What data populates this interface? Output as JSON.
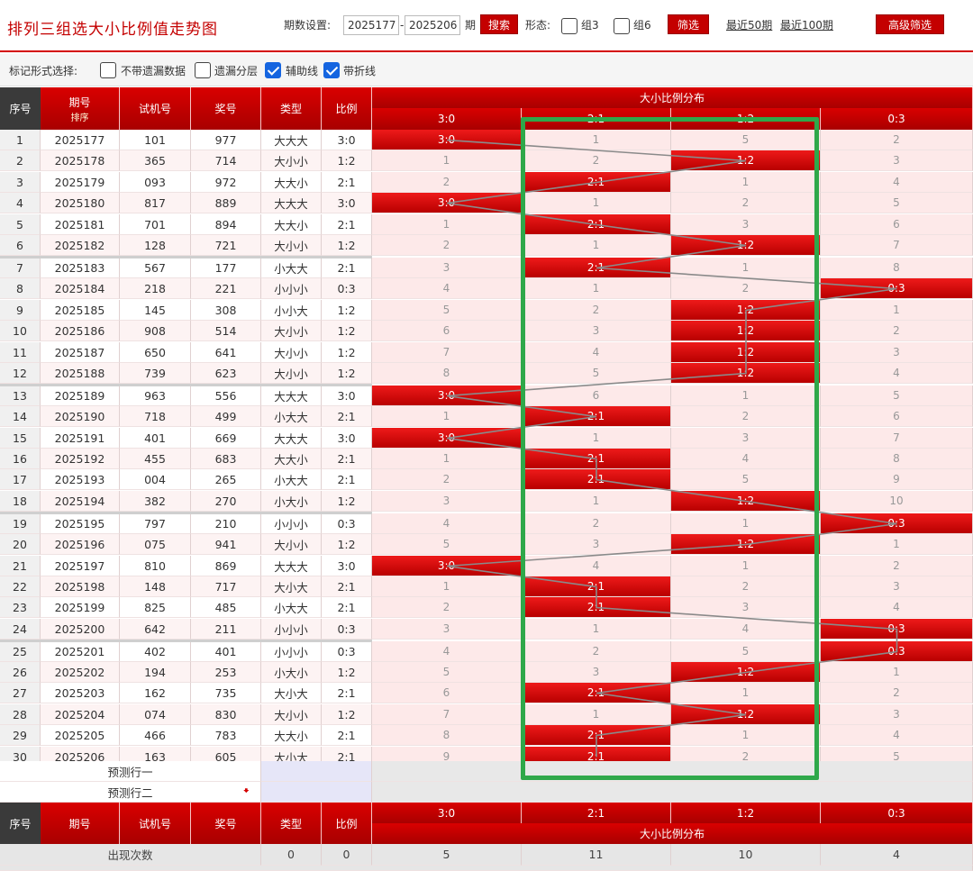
{
  "header": {
    "title": "排列三组选大小比例值走势图",
    "period_label": "期数设置:",
    "period_from": "2025177",
    "period_dash": "-",
    "period_to": "2025206",
    "period_unit": "期",
    "search_button": "搜索",
    "form_label": "形态:",
    "group3_label": "组3",
    "group6_label": "组6",
    "filter_button": "筛选",
    "recent50": "最近50期",
    "recent100": "最近100期",
    "advanced_button": "高级筛选"
  },
  "mark_options": {
    "label": "标记形式选择:",
    "no_missing": "不带遗漏数据",
    "missing_layer": "遗漏分层",
    "assist_line": "辅助线",
    "fold_line": "带折线",
    "no_missing_checked": false,
    "missing_layer_checked": false,
    "assist_line_checked": true,
    "fold_line_checked": true
  },
  "table_header": {
    "seq": "序号",
    "period": "期号",
    "sort": "排序",
    "test_num": "试机号",
    "prize_num": "奖号",
    "type": "类型",
    "ratio": "比例",
    "distribution": "大小比例分布",
    "ratio_cols": [
      "3:0",
      "2:1",
      "1:2",
      "0:3"
    ]
  },
  "rows": [
    {
      "seq": "1",
      "period": "2025177",
      "test": "101",
      "prize": "977",
      "type": "大大大",
      "ratio": "3:0",
      "hit": 0,
      "cells": [
        "3:0",
        "1",
        "5",
        "2"
      ]
    },
    {
      "seq": "2",
      "period": "2025178",
      "test": "365",
      "prize": "714",
      "type": "大小小",
      "ratio": "1:2",
      "hit": 2,
      "cells": [
        "1",
        "2",
        "1:2",
        "3"
      ]
    },
    {
      "seq": "3",
      "period": "2025179",
      "test": "093",
      "prize": "972",
      "type": "大大小",
      "ratio": "2:1",
      "hit": 1,
      "cells": [
        "2",
        "2:1",
        "1",
        "4"
      ]
    },
    {
      "seq": "4",
      "period": "2025180",
      "test": "817",
      "prize": "889",
      "type": "大大大",
      "ratio": "3:0",
      "hit": 0,
      "cells": [
        "3:0",
        "1",
        "2",
        "5"
      ]
    },
    {
      "seq": "5",
      "period": "2025181",
      "test": "701",
      "prize": "894",
      "type": "大大小",
      "ratio": "2:1",
      "hit": 1,
      "cells": [
        "1",
        "2:1",
        "3",
        "6"
      ]
    },
    {
      "seq": "6",
      "period": "2025182",
      "test": "128",
      "prize": "721",
      "type": "大小小",
      "ratio": "1:2",
      "hit": 2,
      "cells": [
        "2",
        "1",
        "1:2",
        "7"
      ]
    },
    {
      "seq": "7",
      "period": "2025183",
      "test": "567",
      "prize": "177",
      "type": "小大大",
      "ratio": "2:1",
      "hit": 1,
      "cells": [
        "3",
        "2:1",
        "1",
        "8"
      ]
    },
    {
      "seq": "8",
      "period": "2025184",
      "test": "218",
      "prize": "221",
      "type": "小小小",
      "ratio": "0:3",
      "hit": 3,
      "cells": [
        "4",
        "1",
        "2",
        "0:3"
      ]
    },
    {
      "seq": "9",
      "period": "2025185",
      "test": "145",
      "prize": "308",
      "type": "小小大",
      "ratio": "1:2",
      "hit": 2,
      "cells": [
        "5",
        "2",
        "1:2",
        "1"
      ]
    },
    {
      "seq": "10",
      "period": "2025186",
      "test": "908",
      "prize": "514",
      "type": "大小小",
      "ratio": "1:2",
      "hit": 2,
      "cells": [
        "6",
        "3",
        "1:2",
        "2"
      ]
    },
    {
      "seq": "11",
      "period": "2025187",
      "test": "650",
      "prize": "641",
      "type": "大小小",
      "ratio": "1:2",
      "hit": 2,
      "cells": [
        "7",
        "4",
        "1:2",
        "3"
      ]
    },
    {
      "seq": "12",
      "period": "2025188",
      "test": "739",
      "prize": "623",
      "type": "大小小",
      "ratio": "1:2",
      "hit": 2,
      "cells": [
        "8",
        "5",
        "1:2",
        "4"
      ]
    },
    {
      "seq": "13",
      "period": "2025189",
      "test": "963",
      "prize": "556",
      "type": "大大大",
      "ratio": "3:0",
      "hit": 0,
      "cells": [
        "3:0",
        "6",
        "1",
        "5"
      ]
    },
    {
      "seq": "14",
      "period": "2025190",
      "test": "718",
      "prize": "499",
      "type": "小大大",
      "ratio": "2:1",
      "hit": 1,
      "cells": [
        "1",
        "2:1",
        "2",
        "6"
      ]
    },
    {
      "seq": "15",
      "period": "2025191",
      "test": "401",
      "prize": "669",
      "type": "大大大",
      "ratio": "3:0",
      "hit": 0,
      "cells": [
        "3:0",
        "1",
        "3",
        "7"
      ]
    },
    {
      "seq": "16",
      "period": "2025192",
      "test": "455",
      "prize": "683",
      "type": "大大小",
      "ratio": "2:1",
      "hit": 1,
      "cells": [
        "1",
        "2:1",
        "4",
        "8"
      ]
    },
    {
      "seq": "17",
      "period": "2025193",
      "test": "004",
      "prize": "265",
      "type": "小大大",
      "ratio": "2:1",
      "hit": 1,
      "cells": [
        "2",
        "2:1",
        "5",
        "9"
      ]
    },
    {
      "seq": "18",
      "period": "2025194",
      "test": "382",
      "prize": "270",
      "type": "小大小",
      "ratio": "1:2",
      "hit": 2,
      "cells": [
        "3",
        "1",
        "1:2",
        "10"
      ]
    },
    {
      "seq": "19",
      "period": "2025195",
      "test": "797",
      "prize": "210",
      "type": "小小小",
      "ratio": "0:3",
      "hit": 3,
      "cells": [
        "4",
        "2",
        "1",
        "0:3"
      ]
    },
    {
      "seq": "20",
      "period": "2025196",
      "test": "075",
      "prize": "941",
      "type": "大小小",
      "ratio": "1:2",
      "hit": 2,
      "cells": [
        "5",
        "3",
        "1:2",
        "1"
      ]
    },
    {
      "seq": "21",
      "period": "2025197",
      "test": "810",
      "prize": "869",
      "type": "大大大",
      "ratio": "3:0",
      "hit": 0,
      "cells": [
        "3:0",
        "4",
        "1",
        "2"
      ]
    },
    {
      "seq": "22",
      "period": "2025198",
      "test": "148",
      "prize": "717",
      "type": "大小大",
      "ratio": "2:1",
      "hit": 1,
      "cells": [
        "1",
        "2:1",
        "2",
        "3"
      ]
    },
    {
      "seq": "23",
      "period": "2025199",
      "test": "825",
      "prize": "485",
      "type": "小大大",
      "ratio": "2:1",
      "hit": 1,
      "cells": [
        "2",
        "2:1",
        "3",
        "4"
      ]
    },
    {
      "seq": "24",
      "period": "2025200",
      "test": "642",
      "prize": "211",
      "type": "小小小",
      "ratio": "0:3",
      "hit": 3,
      "cells": [
        "3",
        "1",
        "4",
        "0:3"
      ]
    },
    {
      "seq": "25",
      "period": "2025201",
      "test": "402",
      "prize": "401",
      "type": "小小小",
      "ratio": "0:3",
      "hit": 3,
      "cells": [
        "4",
        "2",
        "5",
        "0:3"
      ]
    },
    {
      "seq": "26",
      "period": "2025202",
      "test": "194",
      "prize": "253",
      "type": "小大小",
      "ratio": "1:2",
      "hit": 2,
      "cells": [
        "5",
        "3",
        "1:2",
        "1"
      ]
    },
    {
      "seq": "27",
      "period": "2025203",
      "test": "162",
      "prize": "735",
      "type": "大小大",
      "ratio": "2:1",
      "hit": 1,
      "cells": [
        "6",
        "2:1",
        "1",
        "2"
      ]
    },
    {
      "seq": "28",
      "period": "2025204",
      "test": "074",
      "prize": "830",
      "type": "大小小",
      "ratio": "1:2",
      "hit": 2,
      "cells": [
        "7",
        "1",
        "1:2",
        "3"
      ]
    },
    {
      "seq": "29",
      "period": "2025205",
      "test": "466",
      "prize": "783",
      "type": "大大小",
      "ratio": "2:1",
      "hit": 1,
      "cells": [
        "8",
        "2:1",
        "1",
        "4"
      ]
    },
    {
      "seq": "30",
      "period": "2025206",
      "test": "163",
      "prize": "605",
      "type": "大小大",
      "ratio": "2:1",
      "hit": 1,
      "cells": [
        "9",
        "2:1",
        "2",
        "5"
      ]
    }
  ],
  "predict": {
    "row1": "预测行一",
    "row2": "预测行二"
  },
  "footer": {
    "occurrence_label": "出现次数",
    "type_count": "0",
    "ratio_count": "0",
    "counts": [
      "5",
      "11",
      "10",
      "4"
    ]
  },
  "colors": {
    "brand_red": "#c40000",
    "highlight_green": "#2fa84a",
    "check_blue": "#1565e0"
  }
}
